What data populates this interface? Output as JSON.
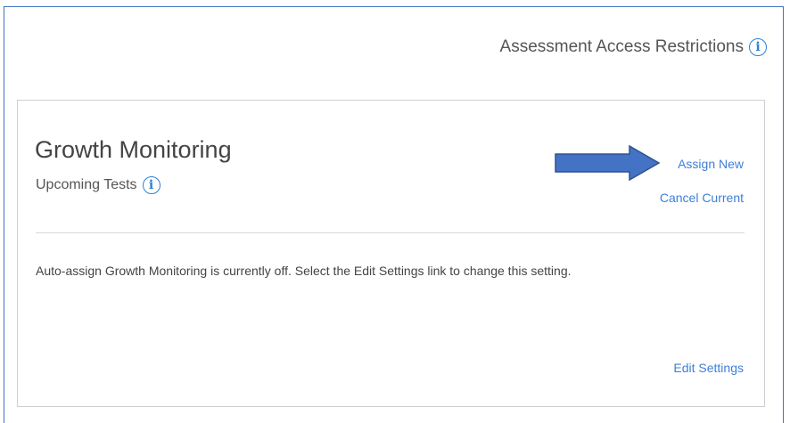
{
  "header": {
    "restrictions_label": "Assessment Access Restrictions"
  },
  "card": {
    "title": "Growth Monitoring",
    "subtitle": "Upcoming Tests",
    "assign_new_label": "Assign New",
    "cancel_current_label": "Cancel Current",
    "message": "Auto-assign Growth Monitoring is currently off. Select the Edit Settings link to change this setting.",
    "edit_settings_label": "Edit Settings"
  },
  "icons": {
    "info": "info-icon",
    "annotation_arrow": "arrow-right-icon"
  },
  "colors": {
    "link": "#3d7fd9",
    "info_icon": "#2f7fd6",
    "arrow_fill": "#4472c4",
    "arrow_stroke": "#2f528f",
    "frame_border": "#4472c4"
  }
}
